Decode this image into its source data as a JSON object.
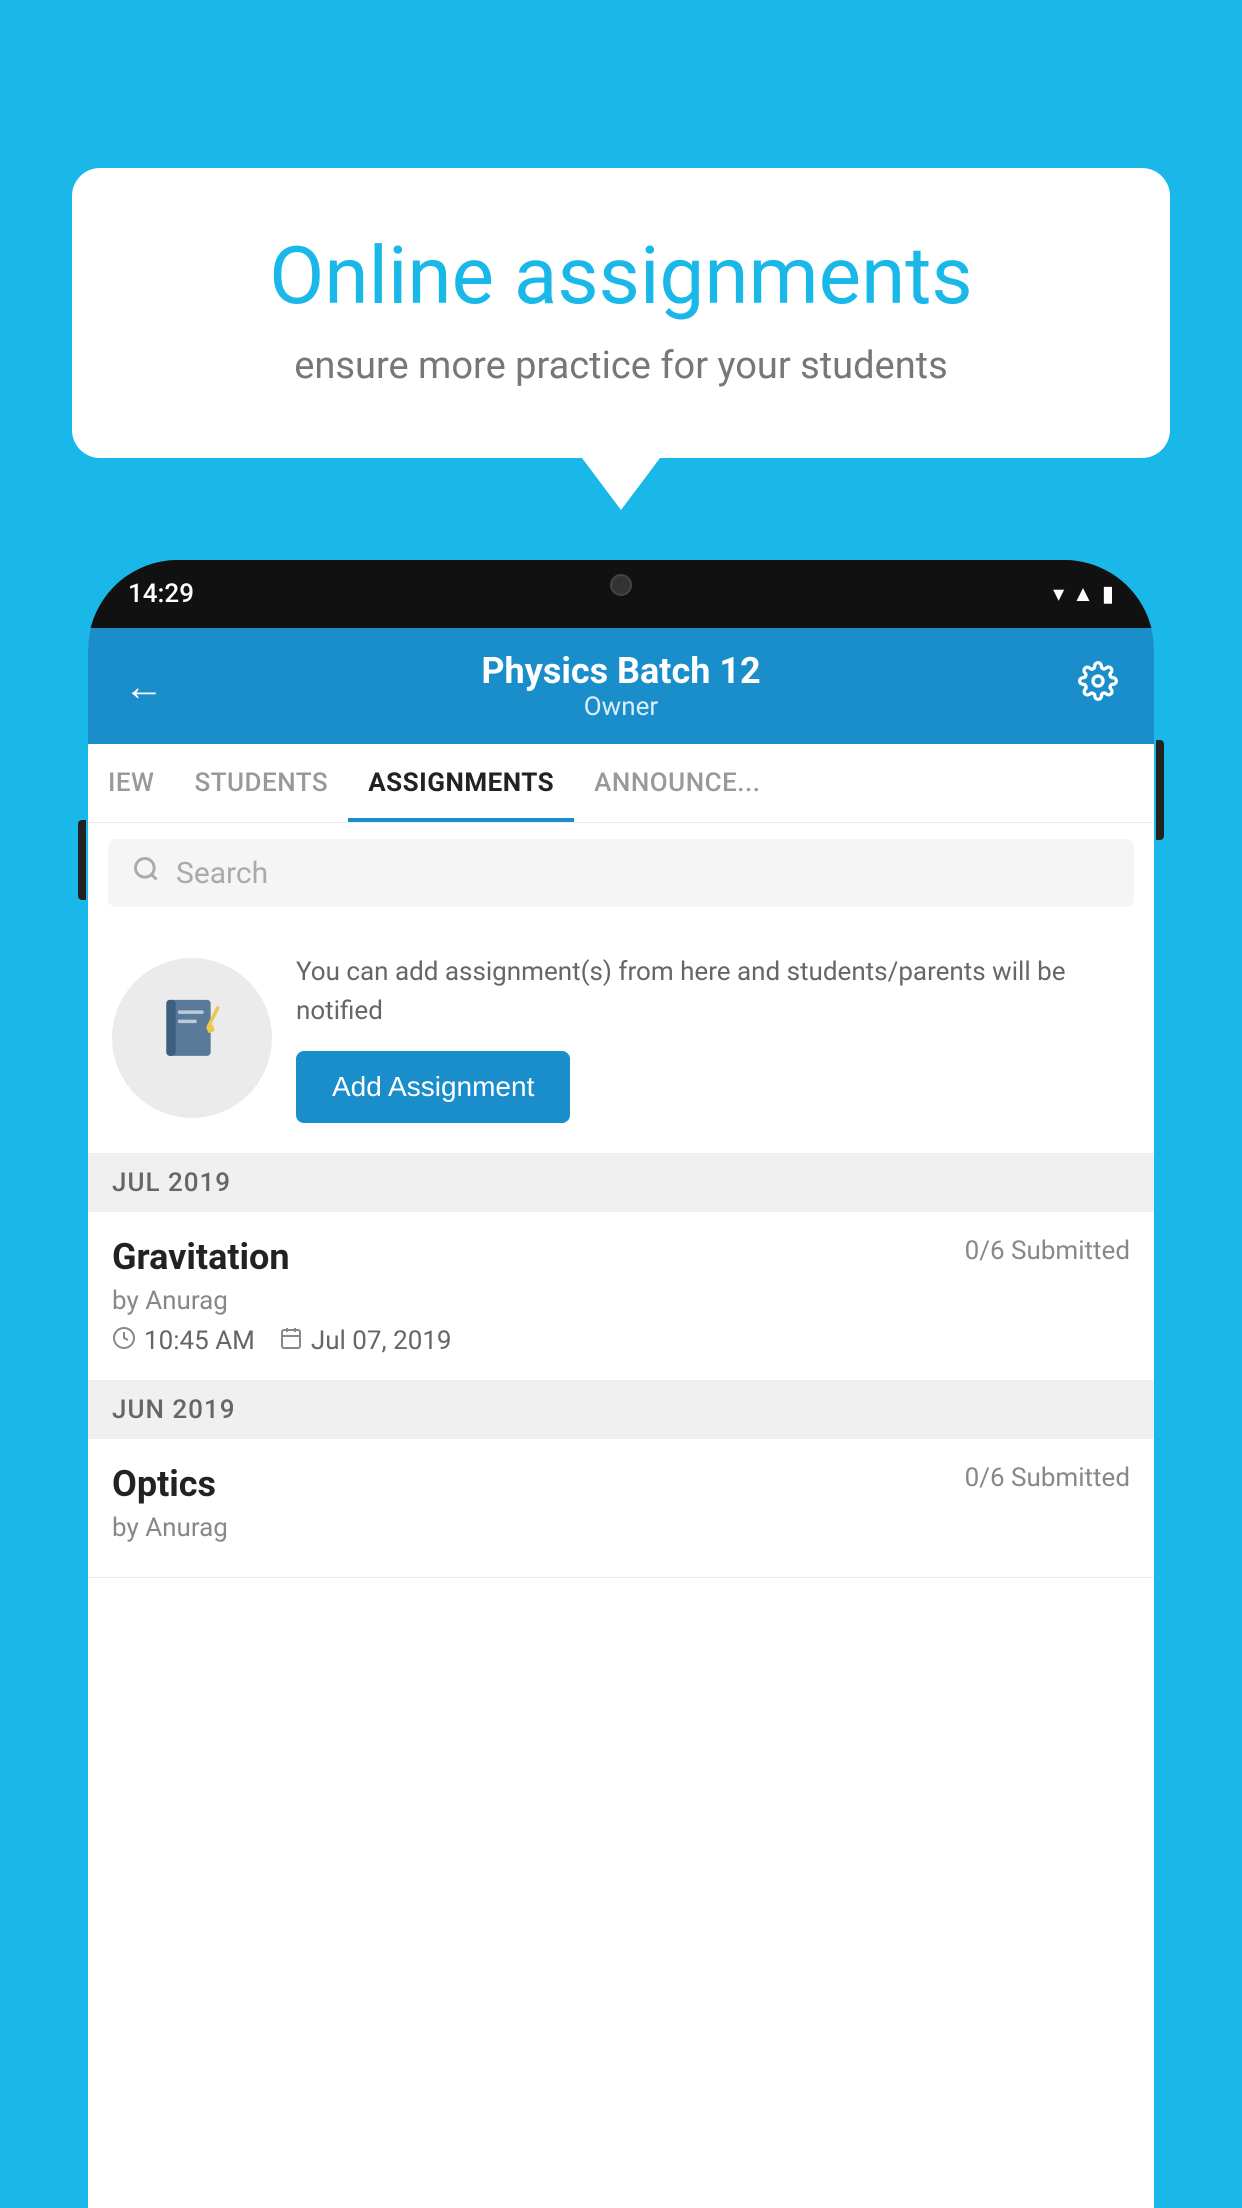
{
  "background_color": "#1ab8e8",
  "speech_bubble": {
    "title": "Online assignments",
    "subtitle": "ensure more practice for your students"
  },
  "phone": {
    "status_bar": {
      "time": "14:29",
      "icons": [
        "wifi",
        "signal",
        "battery"
      ]
    },
    "top_bar": {
      "batch_name": "Physics Batch 12",
      "role": "Owner",
      "back_label": "←",
      "settings_label": "⚙"
    },
    "tabs": [
      {
        "label": "IEW",
        "active": false
      },
      {
        "label": "STUDENTS",
        "active": false
      },
      {
        "label": "ASSIGNMENTS",
        "active": true
      },
      {
        "label": "ANNOUNCE...",
        "active": false
      }
    ],
    "search": {
      "placeholder": "Search"
    },
    "promo": {
      "text": "You can add assignment(s) from here and students/parents will be notified",
      "button_label": "Add Assignment"
    },
    "assignments": [
      {
        "month": "JUL 2019",
        "items": [
          {
            "title": "Gravitation",
            "submitted": "0/6 Submitted",
            "by": "by Anurag",
            "time": "10:45 AM",
            "date": "Jul 07, 2019"
          }
        ]
      },
      {
        "month": "JUN 2019",
        "items": [
          {
            "title": "Optics",
            "submitted": "0/6 Submitted",
            "by": "by Anurag",
            "time": "",
            "date": ""
          }
        ]
      }
    ]
  }
}
